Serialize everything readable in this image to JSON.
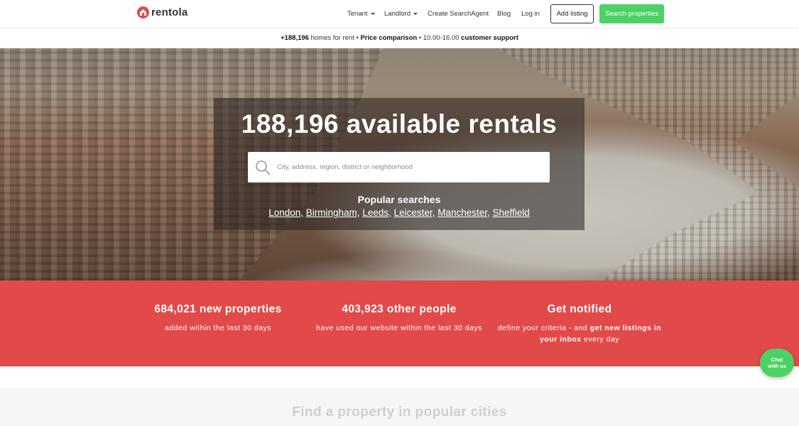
{
  "brand": {
    "name": "rentola",
    "accent": "#e14b4b"
  },
  "nav": {
    "tenant": "Tenant",
    "landlord": "Landlord",
    "search_agent": "Create SearchAgent",
    "blog": "Blog",
    "login": "Log in",
    "add_listing": "Add listing",
    "search_properties": "Search properties",
    "green": "#4cd264"
  },
  "infobar": {
    "count": "+188,196",
    "homes_text": " homes for rent • ",
    "price": "Price comparison",
    "hours_text": " • 10.00-16.00 ",
    "support": "customer support"
  },
  "hero": {
    "title": "188,196 available rentals",
    "search_placeholder": "City, address, region, district or neighborhood",
    "popular_title": "Popular searches",
    "popular_links": [
      "London,",
      "Birmingham,",
      "Leeds,",
      "Leicester,",
      "Manchester,",
      "Sheffield"
    ]
  },
  "stats": {
    "color": "#e24a4a",
    "items": [
      {
        "title": "684,021 new properties",
        "desc": "added within the last 30 days"
      },
      {
        "title": "403,923 other people",
        "desc": "have used our website within the last 30 days"
      },
      {
        "title": "Get notified",
        "desc_a": "define your criteria - and ",
        "desc_b": "get new listings in your inbox",
        "desc_c": " every day"
      }
    ]
  },
  "lower": {
    "title": "Find a property in popular cities"
  },
  "chat": {
    "line1": "Chat",
    "line2": "with us"
  }
}
